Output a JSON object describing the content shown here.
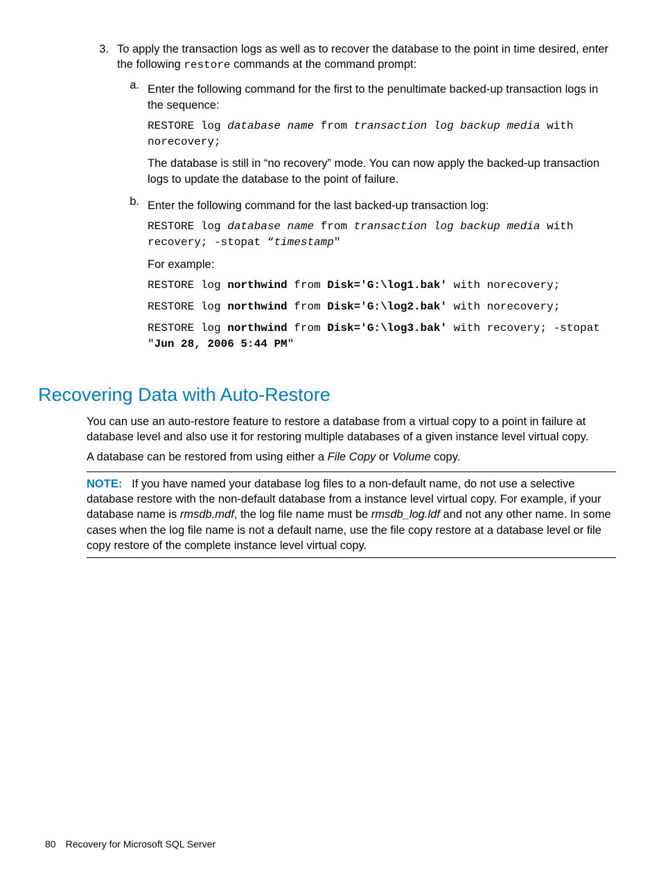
{
  "step3": {
    "marker": "3.",
    "intro_a": "To apply the transaction logs as well as to recover the database to the point in time desired, enter the following ",
    "intro_code": "restore",
    "intro_b": " commands at the command prompt:",
    "a": {
      "marker": "a.",
      "text": "Enter the following command for the first to the penultimate backed-up transaction logs in the sequence:",
      "code_1a": "RESTORE log ",
      "code_1b": "database name",
      "code_1c": " from ",
      "code_1d": "transaction log backup media",
      "code_1e": " with norecovery;",
      "after": "The database is still in “no recovery” mode. You can now apply the backed-up transaction logs to update the database to the point of failure."
    },
    "b": {
      "marker": "b.",
      "text": "Enter the following command for the last backed-up transaction log:",
      "code_1a": "RESTORE log ",
      "code_1b": "database name",
      "code_1c": " from ",
      "code_1d": "transaction log backup media",
      "code_1e": " with recovery; -stopat “",
      "code_1f": "timestamp",
      "code_1g": "\"",
      "for_example": "For example:",
      "ex1_a": "RESTORE log ",
      "ex1_b": "northwind",
      "ex1_c": " from ",
      "ex1_d": "Disk='G:\\log1.bak'",
      "ex1_e": " with norecovery;",
      "ex2_a": "RESTORE log ",
      "ex2_b": "northwind",
      "ex2_c": " from ",
      "ex2_d": "Disk='G:\\log2.bak'",
      "ex2_e": " with norecovery;",
      "ex3_a": "RESTORE log ",
      "ex3_b": "northwind",
      "ex3_c": " from ",
      "ex3_d": "Disk='G:\\log3.bak'",
      "ex3_e": " with recovery; -stopat \"",
      "ex3_f": "Jun 28, 2006 5:44 PM",
      "ex3_g": "\""
    }
  },
  "section_heading": "Recovering Data with Auto-Restore",
  "section_p1": "You can use an auto-restore feature to restore a database from a virtual copy to a point in failure at database level and also use it for restoring multiple databases of a given instance level virtual copy.",
  "section_p2_a": "A database can be restored from using either a ",
  "section_p2_b": "File Copy",
  "section_p2_c": " or ",
  "section_p2_d": "Volume",
  "section_p2_e": " copy.",
  "note_label": "NOTE:",
  "note_a": "If you have named your database log files to a non-default name, do not use a selective database restore with the non-default database from a instance level virtual copy. For example, if your database name is ",
  "note_b": "rmsdb.mdf",
  "note_c": ", the log file name must be ",
  "note_d": "rmsdb_log.ldf",
  "note_e": " and not any other name. In some cases when the log file name is not a default name, use the file copy restore at a database level or file copy restore of the complete instance level virtual copy.",
  "footer_page": "80",
  "footer_title": "Recovery for Microsoft SQL Server"
}
